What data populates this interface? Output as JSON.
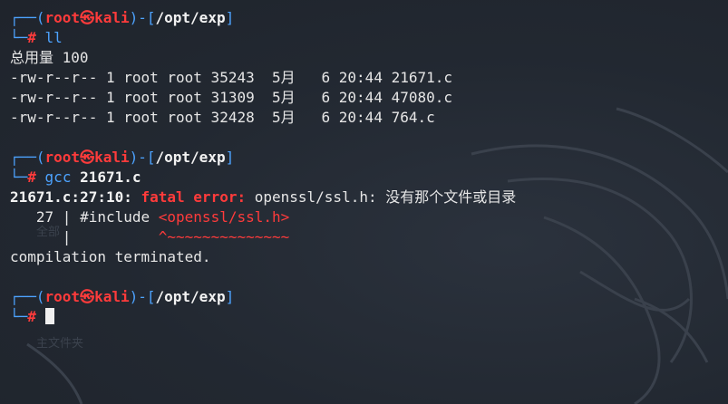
{
  "prompt": {
    "frame_top": "┌──(",
    "user": "root",
    "at": "㉿",
    "host": "kali",
    "mid": ")-[",
    "path": "/opt/exp",
    "end": "]",
    "frame_bottom": "└─",
    "symbol": "#"
  },
  "block1": {
    "command": "ll",
    "total": "总用量 100",
    "files": [
      "-rw-r--r-- 1 root root 35243  5月   6 20:44 21671.c",
      "-rw-r--r-- 1 root root 31309  5月   6 20:44 47080.c",
      "-rw-r--r-- 1 root root 32428  5月   6 20:44 764.c"
    ]
  },
  "block2": {
    "command_name": "gcc",
    "command_arg": "21671.c",
    "err_location": "21671.c:27:10:",
    "err_fatal": "fatal error:",
    "err_message": "openssl/ssl.h: 没有那个文件或目录",
    "src_line_no": "   27 | ",
    "src_code": "#include ",
    "src_highlight": "<openssl/ssl.h>",
    "caret_gutter": "      | ",
    "caret_pad": "         ",
    "caret_marker": "^~~~~~~~~~~~~~~",
    "terminated": "compilation terminated."
  },
  "background": {
    "ghost_texts": [
      "全部",
      "主文件夹"
    ]
  },
  "colors": {
    "background": "#232933",
    "prompt_frame": "#4da3ff",
    "prompt_user": "#ff3b3b",
    "text": "#e6e6e6",
    "error": "#ff3b3b"
  }
}
